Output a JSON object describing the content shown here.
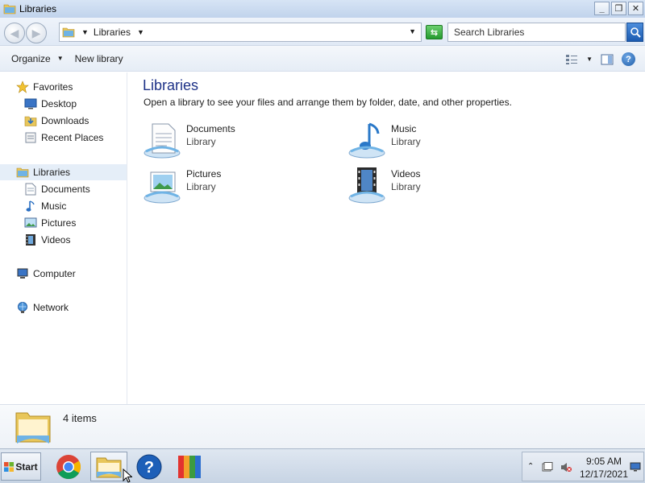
{
  "window": {
    "title": "Libraries",
    "controls": {
      "minimize": "_",
      "maximize": "❐",
      "close": "✕"
    }
  },
  "address": {
    "breadcrumb": "Libraries",
    "search_placeholder": "Search Libraries"
  },
  "toolbar": {
    "organize_label": "Organize",
    "new_library_label": "New library"
  },
  "nav": {
    "favorites": "Favorites",
    "favorites_items": [
      "Desktop",
      "Downloads",
      "Recent Places"
    ],
    "libraries": "Libraries",
    "libraries_items": [
      "Documents",
      "Music",
      "Pictures",
      "Videos"
    ],
    "computer": "Computer",
    "network": "Network"
  },
  "content": {
    "heading": "Libraries",
    "description": "Open a library to see your files and arrange them by folder, date, and other properties.",
    "libraries": [
      {
        "name": "Documents",
        "type": "Library",
        "icon": "documents-library-icon"
      },
      {
        "name": "Music",
        "type": "Library",
        "icon": "music-library-icon"
      },
      {
        "name": "Pictures",
        "type": "Library",
        "icon": "pictures-library-icon"
      },
      {
        "name": "Videos",
        "type": "Library",
        "icon": "videos-library-icon"
      }
    ]
  },
  "details": {
    "item_count": "4 items"
  },
  "taskbar": {
    "start_label": "Start",
    "apps": [
      "chrome-icon",
      "windows-explorer-icon",
      "help-icon",
      "avg-icon"
    ],
    "time": "9:05 AM",
    "date": "12/17/2021"
  },
  "colors": {
    "heading": "#1e3287",
    "selection": "#e5eef8",
    "titlebar": "#c1d3ec"
  }
}
